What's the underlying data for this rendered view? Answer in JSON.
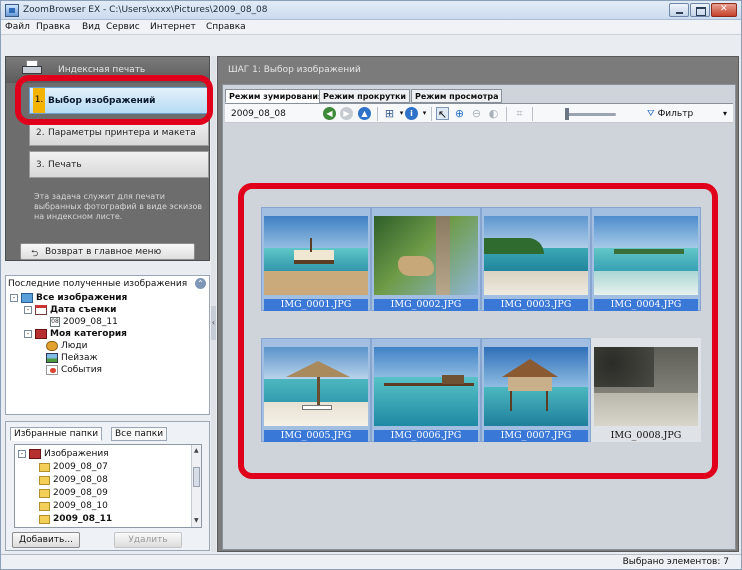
{
  "window": {
    "title": "ZoomBrowser EX - C:\\Users\\xxxx\\Pictures\\2009_08_08"
  },
  "menu": [
    "Файл",
    "Правка",
    "Вид",
    "Сервис",
    "Интернет",
    "Справка"
  ],
  "left_panel": {
    "title": "Индексная печать",
    "steps": [
      {
        "num": "1.",
        "label": "Выбор изображений",
        "active": true
      },
      {
        "num": "2.",
        "label": "Параметры принтера и макета",
        "active": false
      },
      {
        "num": "3.",
        "label": "Печать",
        "active": false
      }
    ],
    "description": "Эта задача служит для печати выбранных фотографий в виде эскизов на индексном листе.",
    "back_button": "Возврат в главное меню"
  },
  "recent": {
    "title": "Последние полученные изображения",
    "tree": [
      {
        "label": "Все изображения",
        "bold": true,
        "icon": "images-icon",
        "expander": "-"
      },
      {
        "label": "Дата съемки",
        "bold": true,
        "icon": "calendar-icon",
        "expander": "-"
      },
      {
        "label": "2009_08_11",
        "bold": false,
        "icon": "date-icon",
        "icon_text": "08",
        "expander": ""
      },
      {
        "label": "Моя категория",
        "bold": true,
        "icon": "category-icon",
        "expander": "-"
      },
      {
        "label": "Люди",
        "bold": false,
        "icon": "people-icon",
        "expander": ""
      },
      {
        "label": "Пейзаж",
        "bold": false,
        "icon": "landscape-icon",
        "expander": ""
      },
      {
        "label": "События",
        "bold": false,
        "icon": "events-icon",
        "expander": ""
      }
    ]
  },
  "favorites": {
    "tabs": [
      "Избранные папки",
      "Все папки"
    ],
    "items": [
      "Изображения",
      "2009_08_07",
      "2009_08_08",
      "2009_08_09",
      "2009_08_10",
      "2009_08_11"
    ],
    "add_button": "Добавить...",
    "remove_button": "Удалить"
  },
  "right_panel": {
    "step_title": "ШАГ 1: Выбор изображений",
    "view_tabs": [
      "Режим зумирования",
      "Режим прокрутки",
      "Режим просмотра"
    ],
    "toolbar": {
      "date": "2009_08_08",
      "filter_label": "Фильтр"
    },
    "thumbnails": [
      {
        "name": "IMG_0001.JPG",
        "selected": true
      },
      {
        "name": "IMG_0002.JPG",
        "selected": true
      },
      {
        "name": "IMG_0003.JPG",
        "selected": true
      },
      {
        "name": "IMG_0004.JPG",
        "selected": true
      },
      {
        "name": "IMG_0005.JPG",
        "selected": true
      },
      {
        "name": "IMG_0006.JPG",
        "selected": true
      },
      {
        "name": "IMG_0007.JPG",
        "selected": true
      },
      {
        "name": "IMG_0008.JPG",
        "selected": false
      }
    ]
  },
  "status": {
    "text": "Выбрано элементов: 7"
  },
  "colors": {
    "highlight_ring": "#e0001b",
    "selection": "#3a78d8",
    "active_step_marker": "#f4b300"
  }
}
